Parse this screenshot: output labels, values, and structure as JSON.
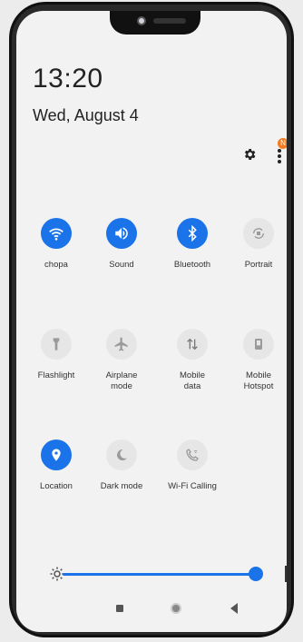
{
  "status": {
    "time": "13:20",
    "date": "Wed, August 4",
    "notification_badge": "N"
  },
  "tiles": [
    {
      "label": "chopa",
      "icon": "wifi-icon",
      "state": "on"
    },
    {
      "label": "Sound",
      "icon": "sound-icon",
      "state": "on"
    },
    {
      "label": "Bluetooth",
      "icon": "bluetooth-icon",
      "state": "on"
    },
    {
      "label": "Portrait",
      "icon": "rotate-icon",
      "state": "off"
    },
    {
      "label": "Flashlight",
      "icon": "flashlight-icon",
      "state": "off"
    },
    {
      "label": "Airplane\nmode",
      "icon": "airplane-icon",
      "state": "off"
    },
    {
      "label": "Mobile\ndata",
      "icon": "mobile-data-icon",
      "state": "off"
    },
    {
      "label": "Mobile\nHotspot",
      "icon": "hotspot-icon",
      "state": "off"
    },
    {
      "label": "Location",
      "icon": "location-icon",
      "state": "on"
    },
    {
      "label": "Dark mode",
      "icon": "moon-icon",
      "state": "off"
    },
    {
      "label": "Wi-Fi Calling",
      "icon": "wifi-calling-icon",
      "state": "off"
    }
  ],
  "brightness": {
    "level": 0.97
  },
  "colors": {
    "accent": "#1a73e8",
    "badge": "#f47b1f",
    "background": "#f2f2f2"
  }
}
